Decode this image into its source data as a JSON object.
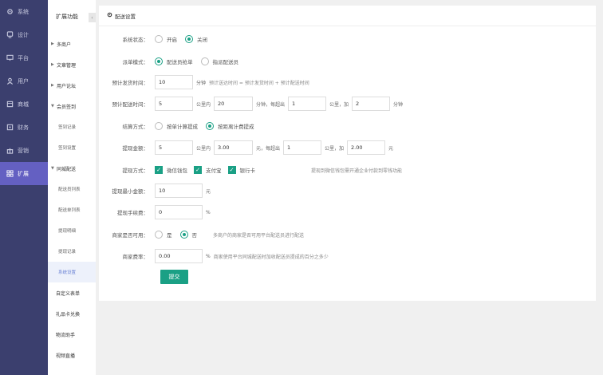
{
  "nav1": {
    "items": [
      {
        "label": "系统",
        "icon": "gear-icon"
      },
      {
        "label": "设计",
        "icon": "monitor-icon"
      },
      {
        "label": "平台",
        "icon": "screen-icon"
      },
      {
        "label": "用户",
        "icon": "user-icon"
      },
      {
        "label": "商城",
        "icon": "shop-icon"
      },
      {
        "label": "财务",
        "icon": "wallet-icon"
      },
      {
        "label": "营销",
        "icon": "gift-icon"
      },
      {
        "label": "扩展",
        "icon": "grid-icon"
      }
    ],
    "active_index": 7
  },
  "nav2": {
    "title": "扩展功能",
    "collapse_glyph": "‹",
    "groups": [
      {
        "label": "多商户"
      },
      {
        "label": "文章管理"
      },
      {
        "label": "用户论坛"
      },
      {
        "label": "会员签到",
        "items": [
          "签到记录",
          "签到设置"
        ]
      },
      {
        "label": "同城配送",
        "items": [
          "配送员列表",
          "配送单列表",
          "提现明细",
          "提现记录",
          "系统设置"
        ]
      }
    ],
    "active_sub": "系统设置",
    "plain": [
      "自定义表单",
      "礼品卡兑换",
      "物流助手",
      "视频直播"
    ]
  },
  "panel": {
    "title": "配送设置",
    "title_icon": "gear-icon",
    "system_status": {
      "label": "系统状态：",
      "options": [
        "开启",
        "关闭"
      ],
      "selected": "关闭"
    },
    "dispatch_mode": {
      "label": "派单模式：",
      "options": [
        "配送员抢单",
        "指派配送员"
      ],
      "selected": "配送员抢单"
    },
    "est_ship_time": {
      "label": "预计发货时间：",
      "value": "10",
      "unit": "分钟",
      "hint": "预计送达时间 = 预计发货时间 + 预计配送时间"
    },
    "est_delivery_time": {
      "label": "预计配送时间：",
      "value1": "5",
      "t1": "公里内",
      "value2": "20",
      "t2": "分钟，每超出",
      "value3": "1",
      "t3": "公里，加",
      "value4": "2",
      "t4": "分钟"
    },
    "settle_mode": {
      "label": "结算方式：",
      "options": [
        "按单计算提成",
        "按距离计费提成"
      ],
      "selected": "按距离计费提成"
    },
    "withdraw_amount": {
      "label": "提现金额：",
      "value1": "5",
      "t1": "公里内",
      "value2": "3.00",
      "t2": "元，每超出",
      "value3": "1",
      "t3": "公里，加",
      "value4": "2.00",
      "t4": "元"
    },
    "withdraw_methods": {
      "label": "提现方式：",
      "options": [
        "微信钱包",
        "支付宝",
        "银行卡"
      ],
      "hint": "提现到微信钱包需开通企业付款到零钱功能"
    },
    "min_withdraw": {
      "label": "提现最小金额：",
      "value": "10",
      "unit": "元"
    },
    "withdraw_fee": {
      "label": "提现手续费：",
      "value": "0",
      "unit": "%"
    },
    "merchant_available": {
      "label": "商家是否可用：",
      "options": [
        "是",
        "否"
      ],
      "selected": "否",
      "hint": "多商户的商家是否可用平台配送员进行配送"
    },
    "merchant_fee": {
      "label": "商家费率：",
      "value": "0.00",
      "unit": "%",
      "hint": "商家使用平台同城配送时加收配送员提成的百分之多少"
    },
    "submit_label": "提交"
  },
  "colors": {
    "sidebar": "#3b3f6e",
    "active": "#6460c2",
    "accent": "#1aa085"
  }
}
